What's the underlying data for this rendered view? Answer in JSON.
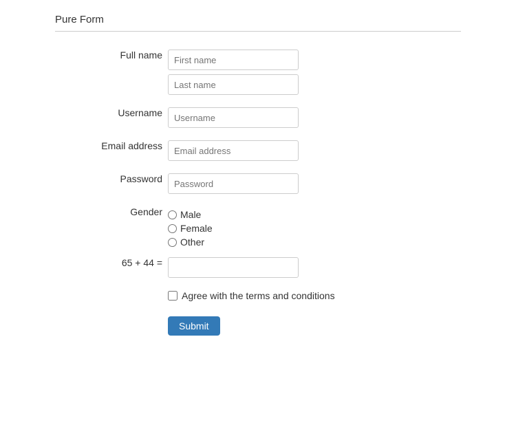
{
  "page": {
    "title": "Pure Form"
  },
  "form": {
    "fields": {
      "fullname_label": "Full name",
      "first_name_placeholder": "First name",
      "last_name_placeholder": "Last name",
      "username_label": "Username",
      "username_placeholder": "Username",
      "email_label": "Email address",
      "email_placeholder": "Email address",
      "password_label": "Password",
      "password_placeholder": "Password",
      "gender_label": "Gender",
      "gender_options": [
        {
          "value": "male",
          "label": "Male"
        },
        {
          "value": "female",
          "label": "Female"
        },
        {
          "value": "other",
          "label": "Other"
        }
      ],
      "captcha_label": "65 + 44 =",
      "captcha_placeholder": "",
      "terms_label": "Agree with the terms and conditions",
      "submit_label": "Submit"
    }
  }
}
